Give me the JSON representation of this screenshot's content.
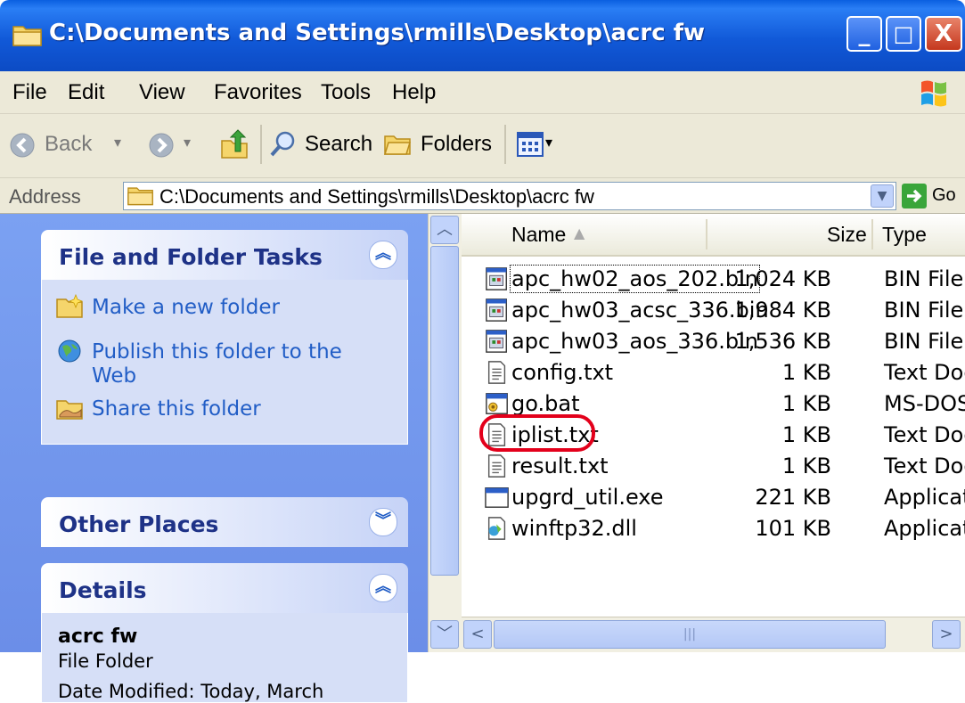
{
  "window": {
    "title": "C:\\Documents and Settings\\rmills\\Desktop\\acrc fw",
    "minimize": "_",
    "maximize": "□",
    "close": "X"
  },
  "menu": [
    "File",
    "Edit",
    "View",
    "Favorites",
    "Tools",
    "Help"
  ],
  "toolbar": {
    "back": "Back",
    "search": "Search",
    "folders": "Folders"
  },
  "address": {
    "label": "Address",
    "path": "C:\\Documents and Settings\\rmills\\Desktop\\acrc fw",
    "go": "Go"
  },
  "sidebar": {
    "file_tasks": {
      "title": "File and Folder Tasks",
      "items": [
        {
          "label": "Make a new folder",
          "icon": "new-folder-icon"
        },
        {
          "label": "Publish this folder to the Web",
          "icon": "publish-web-icon"
        },
        {
          "label": "Share this folder",
          "icon": "share-folder-icon"
        }
      ]
    },
    "other_places": {
      "title": "Other Places"
    },
    "details": {
      "title": "Details",
      "name": "acrc fw",
      "kind": "File Folder",
      "modified": "Date Modified: Today, March"
    }
  },
  "columns": {
    "name": "Name",
    "size": "Size",
    "type": "Type"
  },
  "files": [
    {
      "name": "apc_hw02_aos_202.bin",
      "size": "1,024 KB",
      "type": "BIN File",
      "icon": "bin-file-icon",
      "focused": true
    },
    {
      "name": "apc_hw03_acsc_336.bin",
      "size": "1,984 KB",
      "type": "BIN File",
      "icon": "bin-file-icon"
    },
    {
      "name": "apc_hw03_aos_336.bin",
      "size": "1,536 KB",
      "type": "BIN File",
      "icon": "bin-file-icon"
    },
    {
      "name": "config.txt",
      "size": "1 KB",
      "type": "Text Doc",
      "icon": "text-file-icon"
    },
    {
      "name": "go.bat",
      "size": "1 KB",
      "type": "MS-DOS",
      "icon": "batch-file-icon"
    },
    {
      "name": "iplist.txt",
      "size": "1 KB",
      "type": "Text Doc",
      "icon": "text-file-icon",
      "circled": true
    },
    {
      "name": "result.txt",
      "size": "1 KB",
      "type": "Text Doc",
      "icon": "text-file-icon"
    },
    {
      "name": "upgrd_util.exe",
      "size": "221 KB",
      "type": "Applicatio",
      "icon": "exe-file-icon"
    },
    {
      "name": "winftp32.dll",
      "size": "101 KB",
      "type": "Applicatio",
      "icon": "dll-file-icon"
    }
  ],
  "colors": {
    "title_blue": "#0c4bc4",
    "task_link": "#215dc6",
    "highlight_red": "#e3001b"
  }
}
